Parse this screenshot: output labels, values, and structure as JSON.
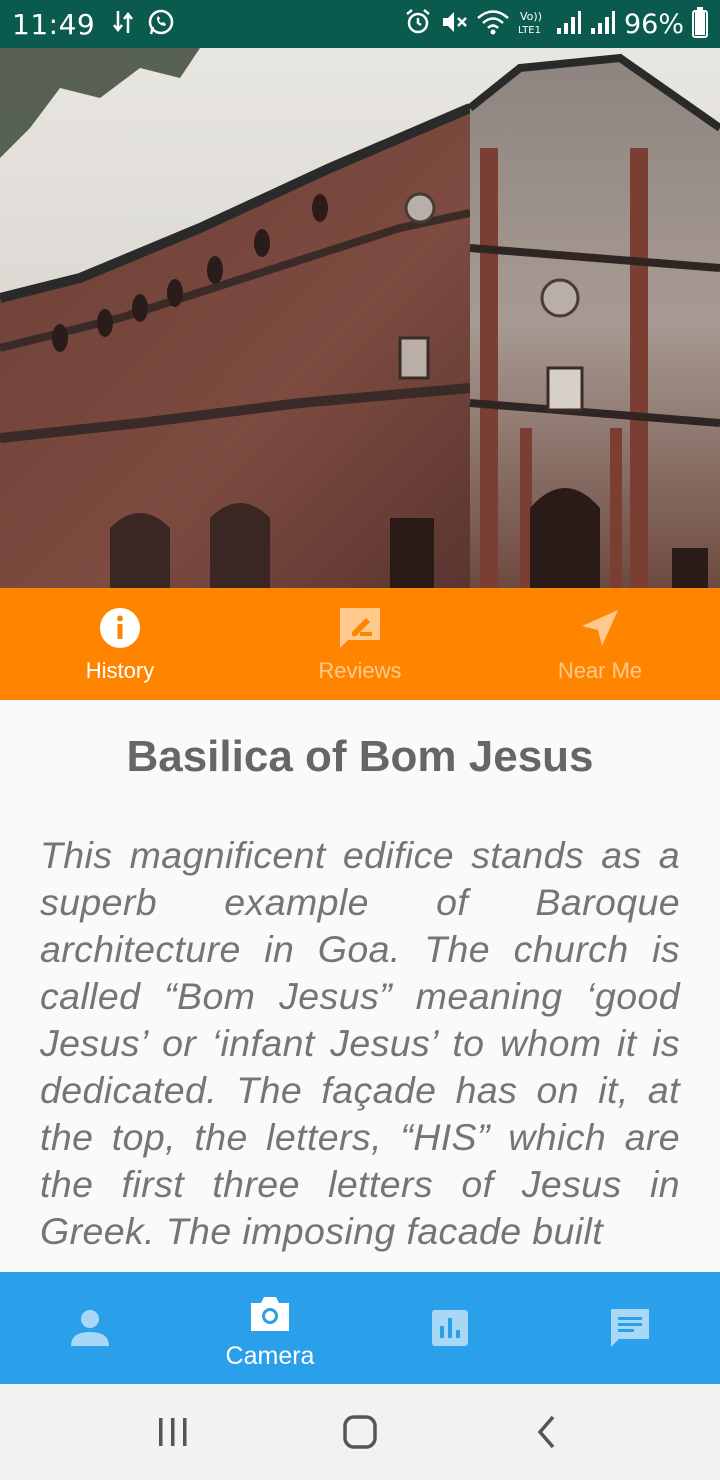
{
  "status_bar": {
    "time": "11:49",
    "battery": "96%",
    "battery_level": 0.96
  },
  "hero": {
    "image_subject": "church-facade-photo"
  },
  "tabs": [
    {
      "label": "History",
      "icon": "info-icon",
      "active": true
    },
    {
      "label": "Reviews",
      "icon": "review-edit-icon",
      "active": false
    },
    {
      "label": "Near Me",
      "icon": "navigation-arrow-icon",
      "active": false
    }
  ],
  "place": {
    "title": "Basilica of Bom Jesus",
    "history": "This magnificent edifice stands as a superb example of Baroque architecture in Goa. The church is called “Bom Jesus” meaning ‘good Jesus’ or ‘infant Jesus’ to whom it is dedicated. The façade has on it, at the top, the letters, “HIS” which are the first three letters of Jesus in Greek. The imposing facade built"
  },
  "bottom_nav": [
    {
      "label": "",
      "icon": "person-icon",
      "active": false
    },
    {
      "label": "Camera",
      "icon": "camera-icon",
      "active": true
    },
    {
      "label": "",
      "icon": "bar-chart-icon",
      "active": false
    },
    {
      "label": "",
      "icon": "chat-icon",
      "active": false
    }
  ],
  "colors": {
    "status_bar": "#0b5a4e",
    "tab_bar": "#ff8500",
    "bottom_nav": "#2a9fea",
    "title_text": "#666666",
    "body_text": "#757575"
  }
}
